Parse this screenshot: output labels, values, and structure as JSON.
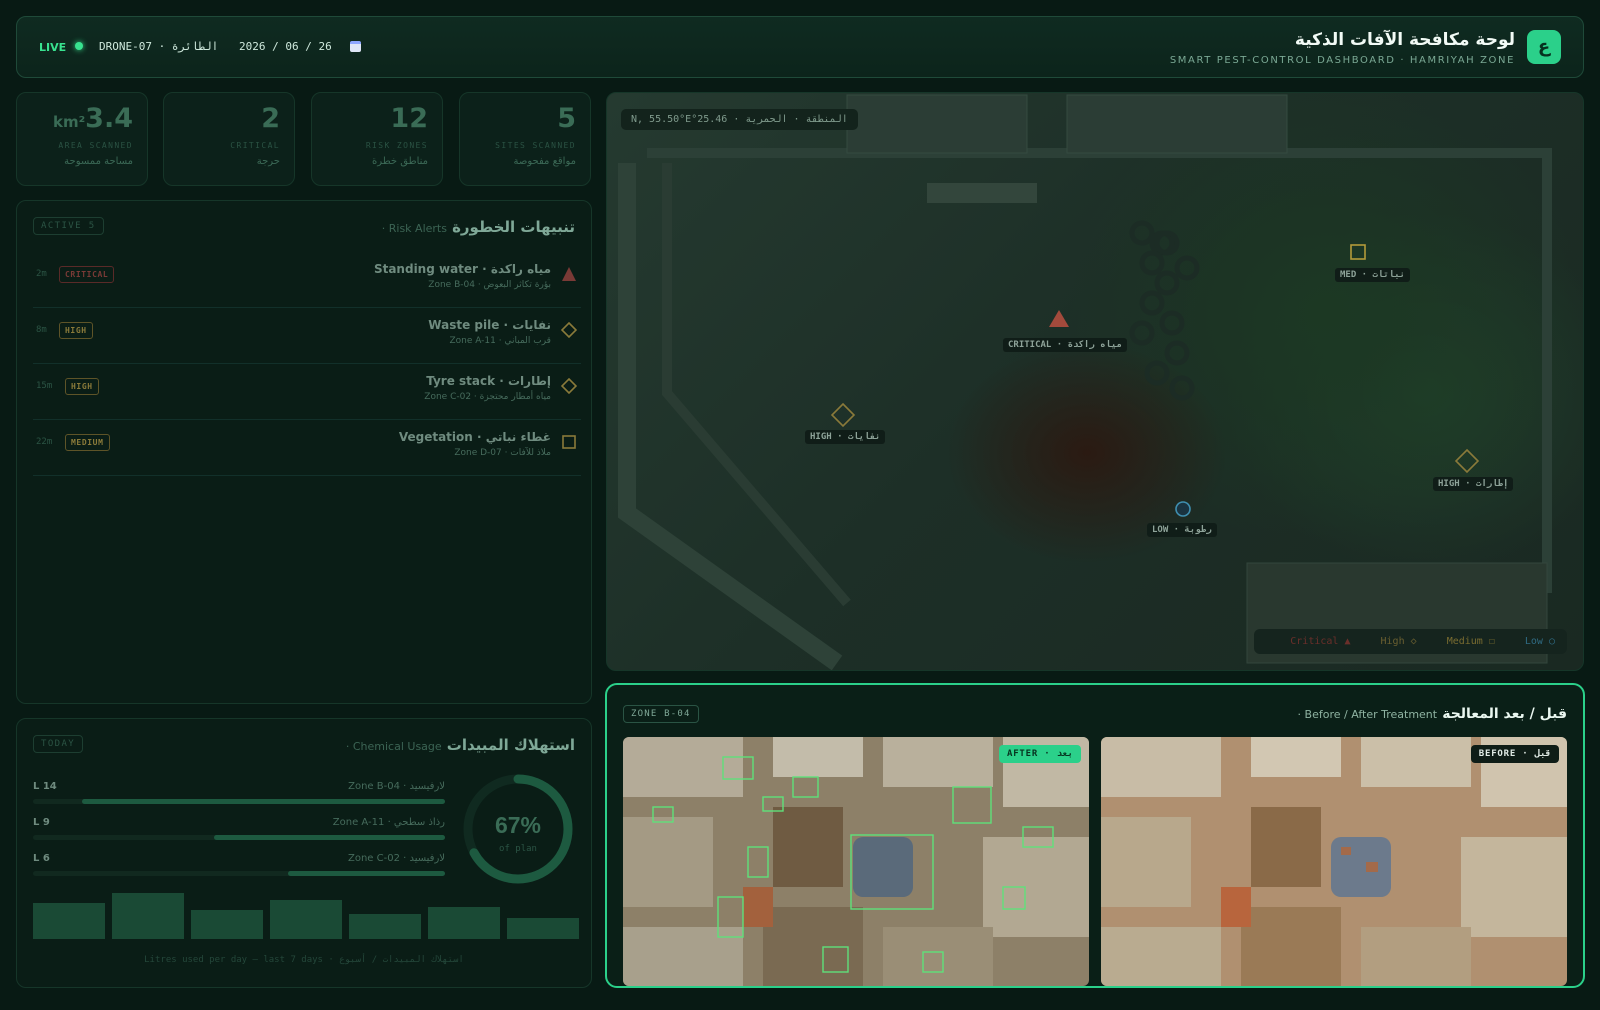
{
  "header": {
    "logo_letter": "ع",
    "title": "لوحة مكافحة الآفات الذكية",
    "subtitle": "SMART PEST-CONTROL DASHBOARD · HAMRIYAH ZONE",
    "live": "LIVE",
    "drone": "DRONE-07 · الطائرة",
    "date": "2026 / 06 / 26",
    "calendar_icon": "calendar-icon"
  },
  "stats": [
    {
      "value": "5",
      "unit": "",
      "en": "SITES SCANNED",
      "ar": "مواقع مفحوصة"
    },
    {
      "value": "12",
      "unit": "",
      "en": "RISK ZONES",
      "ar": "مناطق خطرة"
    },
    {
      "value": "2",
      "unit": "",
      "en": "CRITICAL",
      "ar": "حرجة"
    },
    {
      "value": "3.4",
      "unit": "km²",
      "en": "AREA SCANNED",
      "ar": "مساحة ممسوحة"
    }
  ],
  "alerts_panel": {
    "title_ar": "تنبيهات الخطورة",
    "title_en": "Risk Alerts ·",
    "tag": "ACTIVE 5",
    "items": [
      {
        "time": "2m",
        "level": "CRITICAL",
        "title": "مياه راكدة · Standing water",
        "sub": "بؤرة تكاثر البعوض · Zone B-04",
        "icon": "triangle-warning-icon"
      },
      {
        "time": "8m",
        "level": "HIGH",
        "title": "نفايات · Waste pile",
        "sub": "قرب المباني · Zone A-11",
        "icon": "diamond-icon"
      },
      {
        "time": "15m",
        "level": "HIGH",
        "title": "إطارات · Tyre stack",
        "sub": "مياه أمطار محتجزة · Zone C-02",
        "icon": "diamond-icon"
      },
      {
        "time": "22m",
        "level": "MEDIUM",
        "title": "غطاء نباتي · Vegetation",
        "sub": "ملاذ للآفات · Zone D-07",
        "icon": "square-icon"
      }
    ]
  },
  "chemical_panel": {
    "title_ar": "استهلاك المبيدات",
    "title_en": "Chemical Usage ·",
    "tag": "TODAY",
    "rows": [
      {
        "litres": "L 14",
        "label": "لارفيسيد · Zone B-04",
        "fraction": 0.88
      },
      {
        "litres": "L 9",
        "label": "رذاذ سطحي · Zone A-11",
        "fraction": 0.56
      },
      {
        "litres": "L 6",
        "label": "لارفيسيد · Zone C-02",
        "fraction": 0.38
      }
    ],
    "gauge_value": "67%",
    "gauge_fraction": 0.67,
    "gauge_caption": "of plan",
    "bars": [
      0.72,
      0.92,
      0.58,
      0.78,
      0.5,
      0.65,
      0.42
    ],
    "caption": "Litres used per day — last 7 days · استهلاك المبيدات / أسبوع"
  },
  "map": {
    "coord": "N, 55.50°E°25.46 · المنطقة · الحمرية",
    "markers": [
      {
        "label": "CRITICAL · مياه راكدة",
        "level": "critical"
      },
      {
        "label": "MED · نباتات",
        "level": "medium"
      },
      {
        "label": "HIGH · نفايات",
        "level": "high"
      },
      {
        "label": "HIGH · إطارات",
        "level": "high"
      },
      {
        "label": "LOW · رطوبة",
        "level": "low"
      }
    ],
    "legend": {
      "critical": "Critical",
      "high": "High",
      "medium": "Medium",
      "low": "Low"
    },
    "colors": {
      "critical": "#a34a3c",
      "high": "#8a7a3a",
      "medium": "#b39a3a",
      "low": "#3f8fb0"
    }
  },
  "before_after": {
    "title_ar": "قبل / بعد المعالجة",
    "title_en": "Before / After Treatment ·",
    "zone": "ZONE B-04",
    "after_label": "AFTER · بعد",
    "before_label": "BEFORE · قبل"
  }
}
